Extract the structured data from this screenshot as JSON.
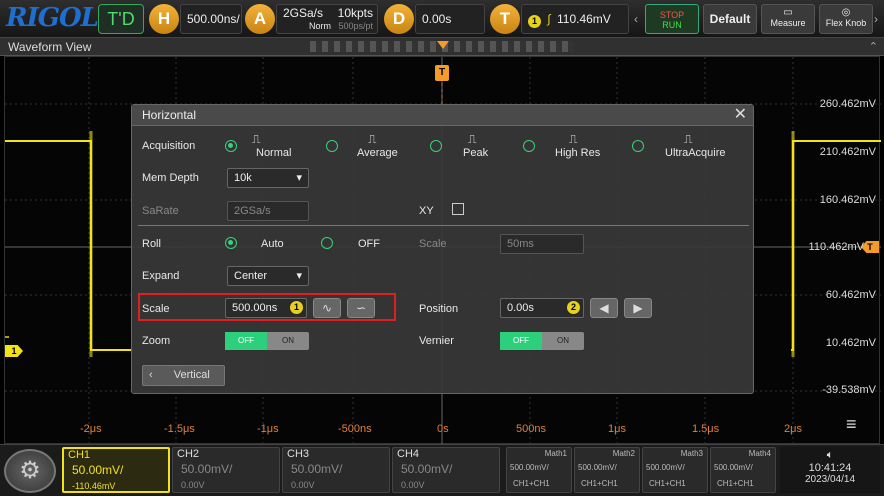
{
  "topbar": {
    "logo": "RIGOL",
    "mode": "T'D",
    "h_letter": "H",
    "h_value": "500.00ns/",
    "a_letter": "A",
    "a_rate": "2GSa/s",
    "a_points": "10kpts",
    "a_mode": "Norm",
    "a_sample": "500ps/pt",
    "d_letter": "D",
    "d_value": "0.00s",
    "t_letter": "T",
    "t_channel": "1",
    "t_level": "110.46mV",
    "t_mode": "A",
    "stop_label": "STOP",
    "run_label": "RUN",
    "default_label": "Default",
    "measure_label": "Measure",
    "flex_label": "Flex Knob"
  },
  "waveform": {
    "title": "Waveform View",
    "trigger_marker": "T",
    "channel_marker": "1",
    "right_labels": [
      "260.462mV",
      "210.462mV",
      "160.462mV",
      "110.462mV",
      "60.462mV",
      "10.462mV",
      "-39.538mV"
    ],
    "x_labels": [
      "-2μs",
      "-1.5μs",
      "-1μs",
      "-500ns",
      "0s",
      "500ns",
      "1μs",
      "1.5μs",
      "2μs"
    ]
  },
  "dialog": {
    "title": "Horizontal",
    "acquisition_label": "Acquisition",
    "acq_modes": [
      "Normal",
      "Average",
      "Peak",
      "High Res",
      "UltraAcquire"
    ],
    "mem_depth_label": "Mem Depth",
    "mem_depth_value": "10k",
    "sarate_label": "SaRate",
    "sarate_value": "2GSa/s",
    "xy_label": "XY",
    "roll_label": "Roll",
    "roll_auto": "Auto",
    "roll_off": "OFF",
    "roll_scale_label": "Scale",
    "roll_scale_value": "50ms",
    "expand_label": "Expand",
    "expand_value": "Center",
    "scale_label": "Scale",
    "scale_value": "500.00ns",
    "scale_badge": "1",
    "position_label": "Position",
    "position_value": "0.00s",
    "position_badge": "2",
    "zoom_label": "Zoom",
    "vernier_label": "Vernier",
    "off": "OFF",
    "on": "ON",
    "vertical_button": "Vertical"
  },
  "channels": [
    {
      "name": "CH1",
      "scale": "50.00mV/",
      "offset": "-110.46mV"
    },
    {
      "name": "CH2",
      "scale": "50.00mV/",
      "offset": "0.00V"
    },
    {
      "name": "CH3",
      "scale": "50.00mV/",
      "offset": "0.00V"
    },
    {
      "name": "CH4",
      "scale": "50.00mV/",
      "offset": "0.00V"
    }
  ],
  "maths": [
    {
      "name": "Math1",
      "scale": "500.00mV/",
      "src": "CH1+CH1"
    },
    {
      "name": "Math2",
      "scale": "500.00mV/",
      "src": "CH1+CH1"
    },
    {
      "name": "Math3",
      "scale": "500.00mV/",
      "src": "CH1+CH1"
    },
    {
      "name": "Math4",
      "scale": "500.00mV/",
      "src": "CH1+CH1"
    }
  ],
  "status": {
    "time": "10:41:24",
    "date": "2023/04/14"
  },
  "colors": {
    "ch1": "#f2e21a",
    "accent": "#f39c2a",
    "green": "#2dd07a"
  }
}
